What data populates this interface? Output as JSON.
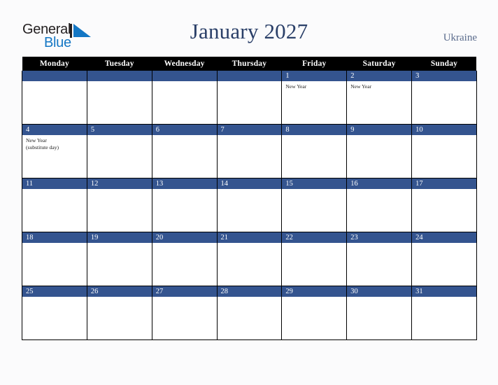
{
  "brand": {
    "name_top": "General",
    "name_bottom": "Blue",
    "mark": "triangle-logo",
    "color_top": "#231f20",
    "color_bottom": "#1477c4"
  },
  "header": {
    "title": "January 2027",
    "country": "Ukraine",
    "title_color": "#2a3f68",
    "country_color": "#5a6b8c"
  },
  "calendar": {
    "accent_color": "#34548f",
    "header_bg": "#000000",
    "weekdays": [
      "Monday",
      "Tuesday",
      "Wednesday",
      "Thursday",
      "Friday",
      "Saturday",
      "Sunday"
    ],
    "weeks": [
      [
        {
          "day": "",
          "events": []
        },
        {
          "day": "",
          "events": []
        },
        {
          "day": "",
          "events": []
        },
        {
          "day": "",
          "events": []
        },
        {
          "day": "1",
          "events": [
            "New Year"
          ]
        },
        {
          "day": "2",
          "events": [
            "New Year"
          ]
        },
        {
          "day": "3",
          "events": []
        }
      ],
      [
        {
          "day": "4",
          "events": [
            "New Year\n(substitute day)"
          ]
        },
        {
          "day": "5",
          "events": []
        },
        {
          "day": "6",
          "events": []
        },
        {
          "day": "7",
          "events": []
        },
        {
          "day": "8",
          "events": []
        },
        {
          "day": "9",
          "events": []
        },
        {
          "day": "10",
          "events": []
        }
      ],
      [
        {
          "day": "11",
          "events": []
        },
        {
          "day": "12",
          "events": []
        },
        {
          "day": "13",
          "events": []
        },
        {
          "day": "14",
          "events": []
        },
        {
          "day": "15",
          "events": []
        },
        {
          "day": "16",
          "events": []
        },
        {
          "day": "17",
          "events": []
        }
      ],
      [
        {
          "day": "18",
          "events": []
        },
        {
          "day": "19",
          "events": []
        },
        {
          "day": "20",
          "events": []
        },
        {
          "day": "21",
          "events": []
        },
        {
          "day": "22",
          "events": []
        },
        {
          "day": "23",
          "events": []
        },
        {
          "day": "24",
          "events": []
        }
      ],
      [
        {
          "day": "25",
          "events": []
        },
        {
          "day": "26",
          "events": []
        },
        {
          "day": "27",
          "events": []
        },
        {
          "day": "28",
          "events": []
        },
        {
          "day": "29",
          "events": []
        },
        {
          "day": "30",
          "events": []
        },
        {
          "day": "31",
          "events": []
        }
      ]
    ]
  }
}
